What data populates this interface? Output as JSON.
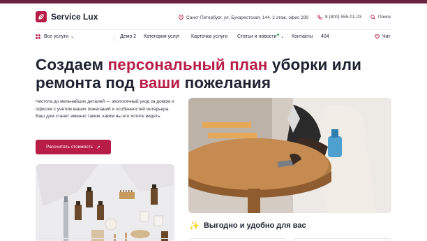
{
  "colors": {
    "accent": "#b81d48",
    "top_bar": "#6b2244",
    "text": "#1e2130",
    "online_dot": "#2fb45a"
  },
  "header": {
    "logo_text": "Service Lux",
    "address": "Санкт-Петербург, ул. Бухарестская, 144. 2 этаж, офис 299",
    "phone": "8 (800) 555-01-23",
    "search_label": "Поиск"
  },
  "nav": {
    "all_services": "Все услуги",
    "items": [
      "Демо 2",
      "Категория услуг",
      "Карточка услуги",
      "Статьи и новости",
      "Контакты",
      "404"
    ],
    "chat": "Чат"
  },
  "hero": {
    "title_part1": "Создаем ",
    "title_accent1": "персональный план",
    "title_part2": " уборки или ремонта под ",
    "title_accent2": "ваши",
    "title_part3": " пожелания",
    "description": "Чистота  до мельчайших деталей — экологичный  уход за домом и офисом с учетом ваших пожеланий и особенностей интерьера. Ваш дом станет именно таким, каким вы его хотите видеть.",
    "cta_label": "Рассчитать стоимость"
  },
  "benefit": {
    "title": "Выгодно и удобно для вас"
  },
  "icons": [
    "logo-icon",
    "location-icon",
    "phone-icon",
    "search-icon",
    "grid-icon",
    "chevron-down-icon",
    "heart-icon",
    "arrow-up-right-icon",
    "sparkle-icon"
  ]
}
